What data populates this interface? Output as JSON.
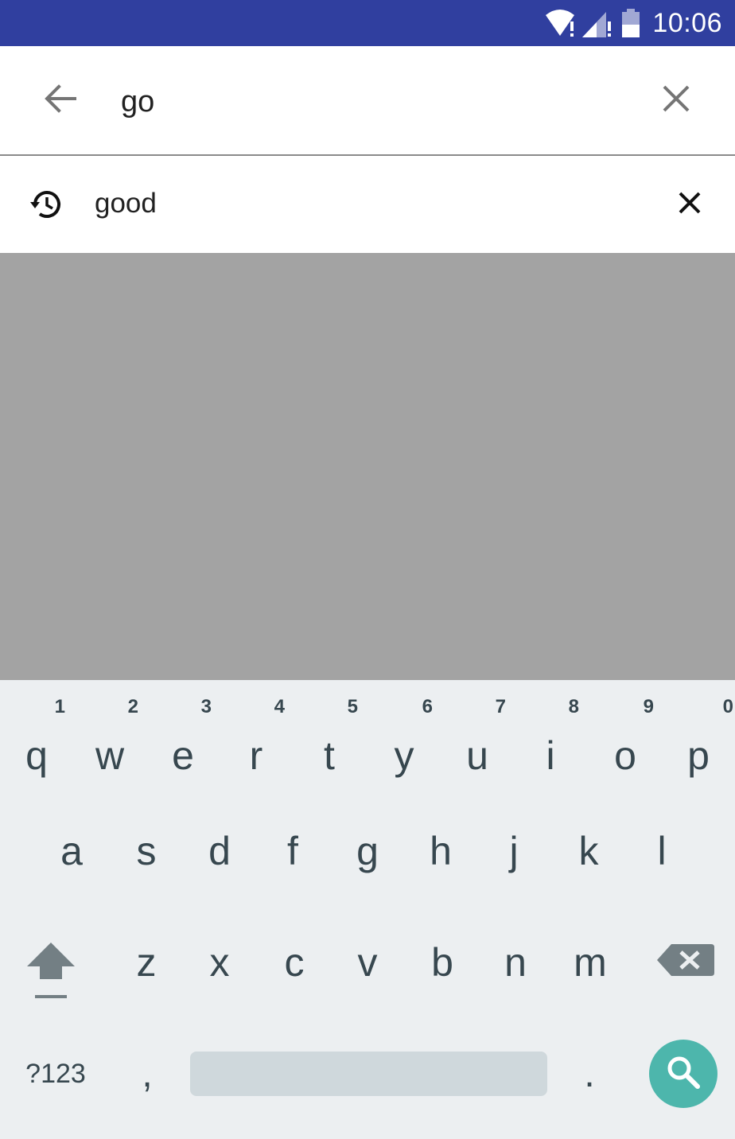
{
  "status_bar": {
    "time": "10:06",
    "background": "#303F9F",
    "icons": [
      "wifi-alert-icon",
      "signal-alert-icon",
      "battery-icon"
    ]
  },
  "search": {
    "back_icon": "arrow-back-icon",
    "query": "go",
    "clear_icon": "close-icon"
  },
  "suggestions": [
    {
      "icon": "history-icon",
      "text": "good",
      "remove_icon": "close-icon"
    }
  ],
  "keyboard": {
    "row1": [
      {
        "key": "q",
        "hint": "1"
      },
      {
        "key": "w",
        "hint": "2"
      },
      {
        "key": "e",
        "hint": "3"
      },
      {
        "key": "r",
        "hint": "4"
      },
      {
        "key": "t",
        "hint": "5"
      },
      {
        "key": "y",
        "hint": "6"
      },
      {
        "key": "u",
        "hint": "7"
      },
      {
        "key": "i",
        "hint": "8"
      },
      {
        "key": "o",
        "hint": "9"
      },
      {
        "key": "p",
        "hint": "0"
      }
    ],
    "row2": [
      "a",
      "s",
      "d",
      "f",
      "g",
      "h",
      "j",
      "k",
      "l"
    ],
    "row3": [
      "z",
      "x",
      "c",
      "v",
      "b",
      "n",
      "m"
    ],
    "symbols_label": "?123",
    "comma": ",",
    "period": ".",
    "action_icon": "search-icon",
    "accent": "#4DB6AC"
  }
}
